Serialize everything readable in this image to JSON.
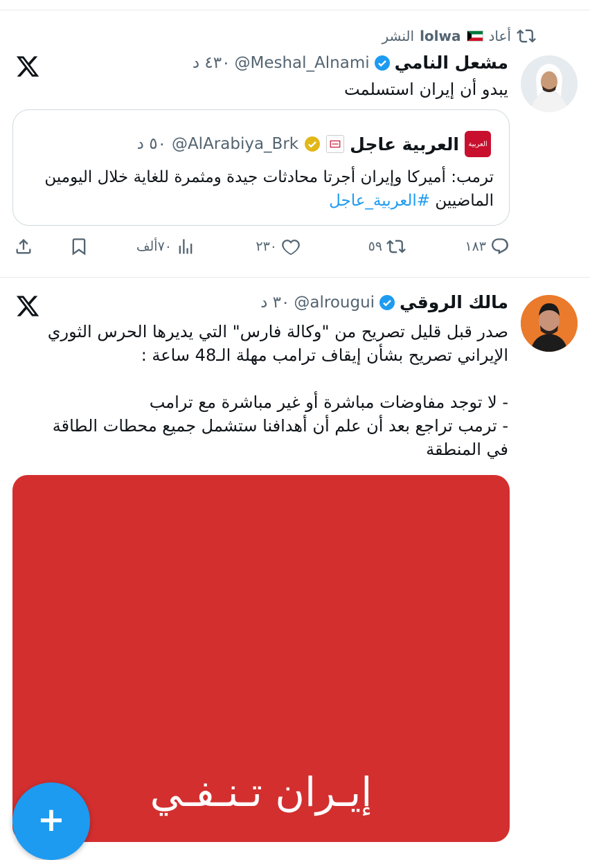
{
  "retweet": {
    "label": "أعاد",
    "user": "lolwa",
    "suffix": "النشر"
  },
  "tweet1": {
    "name": "مشعل النامي",
    "handle": "@Meshal_Alnami",
    "time": "٤٣٠ د",
    "text": "يبدو أن إيران استسلمت",
    "quote": {
      "name": "العربية عاجل",
      "handle": "@AlArabiya_Brk",
      "time": "٥٠ د",
      "text": "ترمب: أميركا وإيران أجرتا محادثات جيدة ومثمرة للغاية خلال اليومين الماضيين",
      "hashtag": "#العربية_عاجل",
      "logo_text": "العربية"
    },
    "actions": {
      "replies": "١٨٣",
      "retweets": "٥٩",
      "likes": "٢٣٠",
      "views": "٧٠ألف"
    }
  },
  "tweet2": {
    "name": "مالك الروقي",
    "handle": "@alrougui",
    "time": "٣٠ د",
    "text_line1": "صدر قبل قليل تصريح من \"وكالة فارس\" التي يديرها الحرس الثوري",
    "text_line2": "الإيراني تصريح بشأن إيقاف ترامب مهلة الـ48 ساعة :",
    "text_line3": "- لا توجد مفاوضات مباشرة أو غير مباشرة مع ترامب",
    "text_line4": "- ترمب تراجع بعد أن علم أن أهدافنا ستشمل جميع محطات الطاقة",
    "text_line5": "في المنطقة",
    "media_text": "إيـران تـنـفـي"
  },
  "fab": {
    "label": "+"
  },
  "colors": {
    "accent": "#1d9bf0",
    "media_bg": "#d32f2f",
    "muted": "#536471"
  }
}
